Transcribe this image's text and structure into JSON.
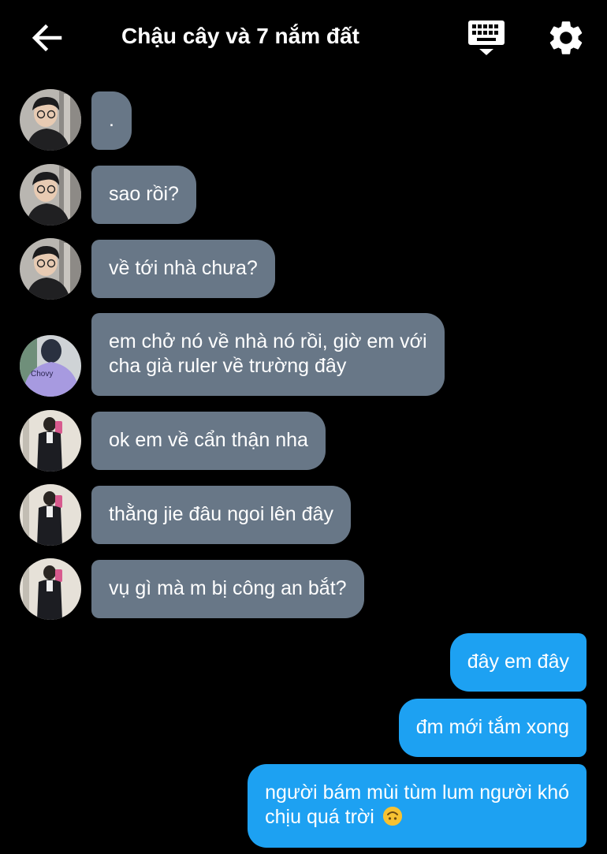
{
  "header": {
    "title": "Chậu cây và 7 nắm đất",
    "back_icon": "arrow-left-icon",
    "keyboard_icon": "keyboard-icon",
    "settings_icon": "gear-icon"
  },
  "colors": {
    "background": "#000000",
    "incoming_bubble": "#687787",
    "outgoing_bubble": "#1da1f2",
    "text": "#ffffff"
  },
  "messages": [
    {
      "direction": "in",
      "sender_avatar": "avatar-a",
      "text": "."
    },
    {
      "direction": "in",
      "sender_avatar": "avatar-a",
      "text": "sao rồi?"
    },
    {
      "direction": "in",
      "sender_avatar": "avatar-a",
      "text": "về tới nhà chưa?"
    },
    {
      "direction": "in",
      "sender_avatar": "avatar-b",
      "text_line1": "em chở nó về nhà nó rồi, giờ em với",
      "text_line2": "cha già ruler về trường đây",
      "jacket_text": "Chovy"
    },
    {
      "direction": "in",
      "sender_avatar": "avatar-c",
      "text": "ok em về cẩn thận nha"
    },
    {
      "direction": "in",
      "sender_avatar": "avatar-c",
      "text": "thằng jie đâu ngoi lên đây"
    },
    {
      "direction": "in",
      "sender_avatar": "avatar-c",
      "text": "vụ gì mà m bị công an bắt?"
    },
    {
      "direction": "out",
      "text": "đây em đây"
    },
    {
      "direction": "out",
      "text": "đm mới tắm xong"
    },
    {
      "direction": "out",
      "text_line1": "người bám mùi tùm lum người khó",
      "text_line2": "chịu quá trời",
      "emoji": "upside-down-face-emoji"
    }
  ]
}
